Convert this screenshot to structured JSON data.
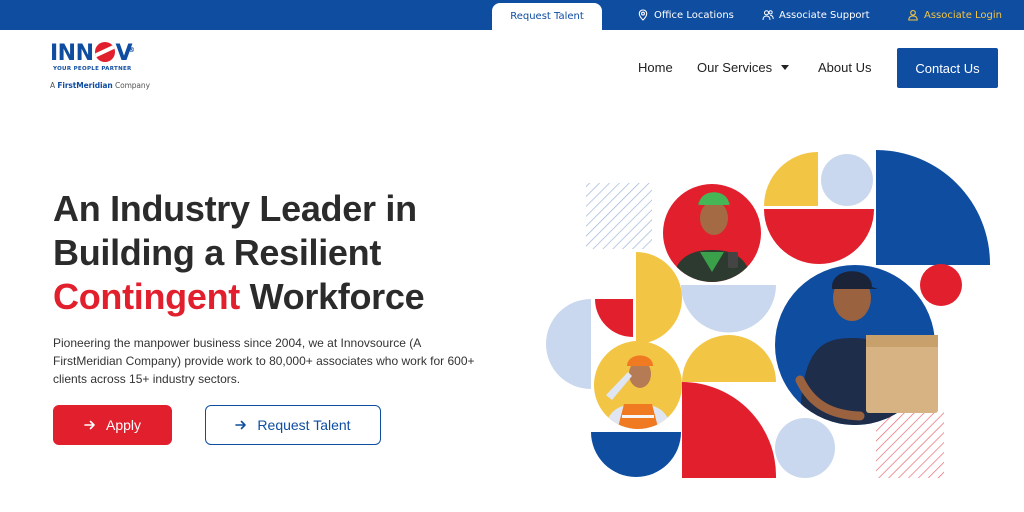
{
  "topbar": {
    "request_talent": "Request Talent",
    "office_locations": "Office Locations",
    "associate_support": "Associate Support",
    "associate_login": "Associate Login"
  },
  "logo": {
    "brand_pre": "INN",
    "brand_post": "V",
    "reg": "®",
    "tagline": "YOUR PEOPLE PARTNER",
    "company_pre": "A",
    "company_name": "FirstMeridian",
    "company_post": "Company"
  },
  "nav": {
    "home": "Home",
    "services": "Our Services",
    "about": "About Us",
    "contact": "Contact Us"
  },
  "hero": {
    "line1": "An Industry Leader in",
    "line2": "Building a Resilient",
    "line3_highlight": "Contingent",
    "line3_rest": " Workforce",
    "description": [
      "Pioneering the manpower business since 2004, we at Innovsource (A",
      "FirstMeridian Company) provide work to 80,000+ associates who work for 600+",
      "clients across 15+ industry sectors."
    ],
    "apply": "Apply",
    "request_talent": "Request Talent"
  },
  "colors": {
    "brand_blue": "#0f4da1",
    "brand_red": "#e21f2d",
    "accent_yellow": "#f3c544",
    "light_blue": "#c9d8ee"
  },
  "icons": {
    "office": "location-pin-icon",
    "support": "people-icon",
    "login": "user-icon",
    "arrow": "arrow-right-icon"
  }
}
